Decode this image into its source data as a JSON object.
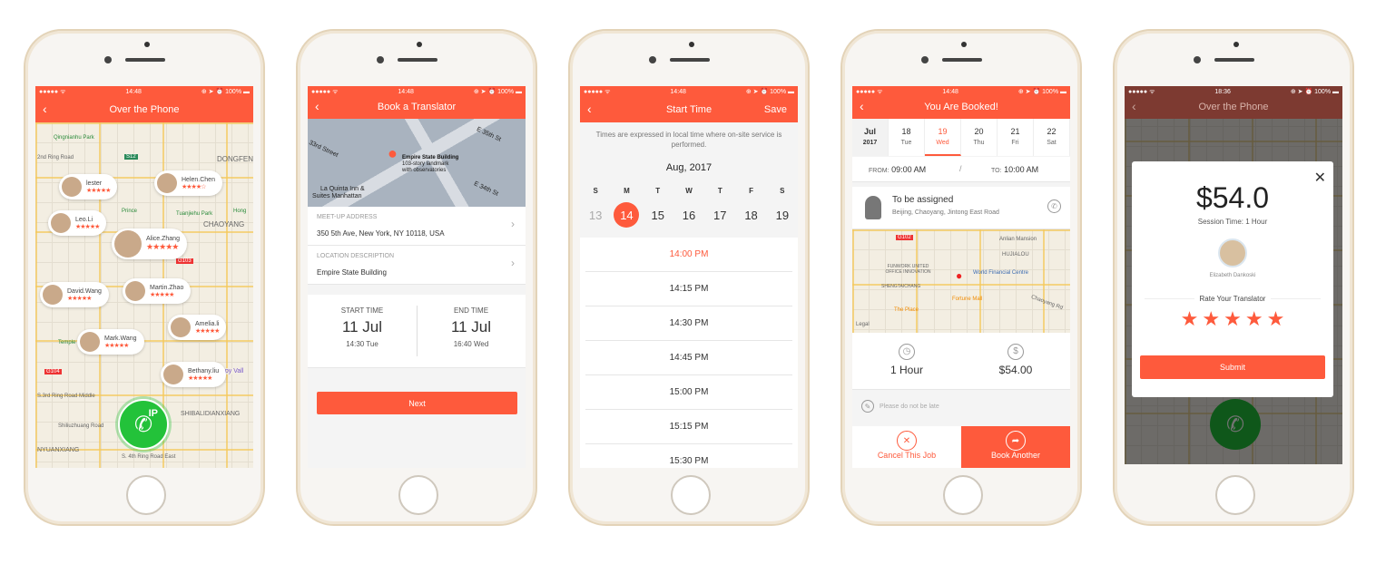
{
  "status": {
    "signal": "●●●●● ᯤ",
    "time": "14:48",
    "battery": "⊕ ➤ ⏰ 100% ▬"
  },
  "screen1": {
    "title": "Over the Phone",
    "map_labels": [
      "Qingnianhu Park",
      "2nd Ring Road",
      "S12",
      "DONGFEN",
      "Prince",
      "Tuanjiehu Park",
      "CHAOYANG",
      "G103",
      "Temple of Heaven",
      "G104",
      "S.3rd Ring Road Middle",
      "SHIBALIDIANXIANG",
      "Shiliuzhuang Road",
      "NYUANXIANG",
      "S. 4th Ring Road East",
      "Hong",
      "ppy Vall"
    ],
    "translators": [
      {
        "name": "lester",
        "stars": "★★★★★"
      },
      {
        "name": "Helen.Chen",
        "stars": "★★★★☆"
      },
      {
        "name": "Leo.Li",
        "stars": "★★★★★"
      },
      {
        "name": "Alice.Zhang",
        "stars": "★★★★★"
      },
      {
        "name": "David.Wang",
        "stars": "★★★★★"
      },
      {
        "name": "Martin.Zhao",
        "stars": "★★★★★"
      },
      {
        "name": "Amelia.li",
        "stars": "★★★★★"
      },
      {
        "name": "Mark.Wang",
        "stars": "★★★★★"
      },
      {
        "name": "Bethany.liu",
        "stars": "★★★★★"
      }
    ],
    "call_badge": "IP"
  },
  "screen2": {
    "title": "Book a Translator",
    "map_labels": [
      "Empire State Building",
      "103-story landmark",
      "with observatories",
      "E 35th St",
      "E 34th St",
      "33rd Street",
      "La Quinta Inn &",
      "Suites Manhattan"
    ],
    "address_label": "MEET-UP ADDRESS",
    "address": "350 5th Ave, New York, NY 10118, USA",
    "desc_label": "LOCATION DESCRIPTION",
    "desc": "Empire State Building",
    "start_label": "START TIME",
    "start_date": "11 Jul",
    "start_time": "14:30 Tue",
    "end_label": "END TIME",
    "end_date": "11 Jul",
    "end_time": "16:40 Wed",
    "next": "Next"
  },
  "screen3": {
    "title": "Start Time",
    "save": "Save",
    "notice": "Times are expressed in local time where on-site service is performed.",
    "month": "Aug, 2017",
    "weekdays": [
      "S",
      "M",
      "T",
      "W",
      "T",
      "F",
      "S"
    ],
    "dates": [
      "13",
      "14",
      "15",
      "16",
      "17",
      "18",
      "19"
    ],
    "selected_date": "14",
    "slots": [
      "14:00 PM",
      "14:15 PM",
      "14:30 PM",
      "14:45 PM",
      "15:00 PM",
      "15:15 PM",
      "15:30 PM"
    ]
  },
  "screen4": {
    "title": "You Are Booked!",
    "month": "Jul",
    "year": "2017",
    "days": [
      {
        "n": "18",
        "d": "Tue"
      },
      {
        "n": "19",
        "d": "Wed"
      },
      {
        "n": "20",
        "d": "Thu"
      },
      {
        "n": "21",
        "d": "Fri"
      },
      {
        "n": "22",
        "d": "Sat"
      }
    ],
    "from_label": "FROM:",
    "from": "09:00 AM",
    "sep": "/",
    "to_label": "TO:",
    "to": "10:00 AM",
    "assignee": "To be assigned",
    "location": "Beijing, Chaoyang, Jintong East Road",
    "map_labels": [
      "G102",
      "Anlian Mansion",
      "HUJIALOU",
      "FUNWORK UNITED OFFICE INNOVATION",
      "SHENGTAICHANG",
      "World Financial Centre",
      "Fortune Mall",
      "The Place",
      "Chaoyang Rd",
      "Legal"
    ],
    "duration": "1 Hour",
    "price": "$54.00",
    "note": "Please do not be late",
    "cancel": "Cancel This Job",
    "book_another": "Book Another"
  },
  "screen5": {
    "status_time": "18:36",
    "title": "Over the Phone",
    "amount": "$54.0",
    "session": "Session Time: 1 Hour",
    "translator": "Elizabeth Dankoski",
    "rate_label": "Rate Your Translator",
    "rating": 5,
    "submit": "Submit"
  },
  "colors": {
    "accent": "#fe5a3c",
    "call_green": "#23c23a"
  }
}
